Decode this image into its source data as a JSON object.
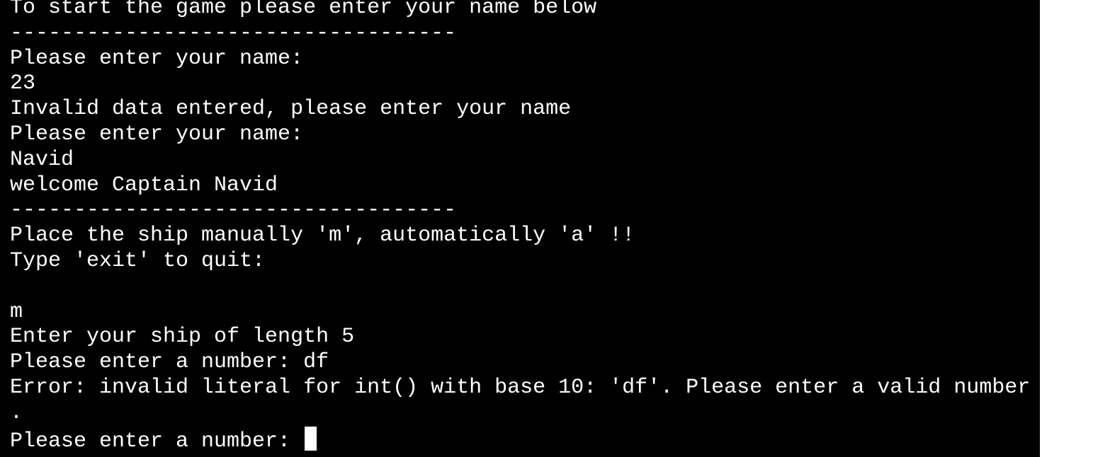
{
  "terminal": {
    "lines": [
      "To start the game please enter your name below",
      "-----------------------------------",
      "Please enter your name:",
      "23",
      "Invalid data entered, please enter your name",
      "Please enter your name:",
      "Navid",
      "welcome Captain Navid",
      "-----------------------------------",
      "Place the ship manually 'm', automatically 'a' !!",
      "Type 'exit' to quit:",
      "",
      "m",
      "Enter your ship of length 5",
      "Please enter a number: df",
      "Error: invalid literal for int() with base 10: 'df'. Please enter a valid number",
      "."
    ],
    "prompt": "Please enter a number: "
  }
}
